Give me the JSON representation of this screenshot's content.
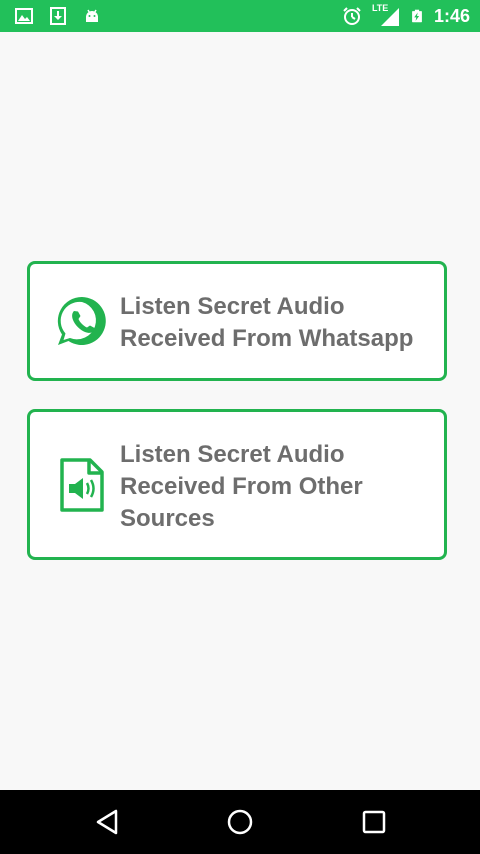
{
  "status_bar": {
    "time": "1:46",
    "network": "LTE",
    "icons": [
      "gallery-icon",
      "download-icon",
      "android-icon",
      "alarm-icon",
      "signal-icon",
      "battery-icon"
    ]
  },
  "cards": [
    {
      "label": "Listen Secret Audio Received From Whatsapp",
      "icon": "whatsapp-icon"
    },
    {
      "label": "Listen Secret Audio Received From Other Sources",
      "icon": "audio-file-icon"
    }
  ],
  "colors": {
    "status_bar": "#22c05a",
    "accent": "#22b34f",
    "label_text": "#6d6d6d",
    "nav_bar": "#000000"
  },
  "nav_bar": {
    "buttons": [
      "back-icon",
      "home-icon",
      "recent-apps-icon"
    ]
  }
}
